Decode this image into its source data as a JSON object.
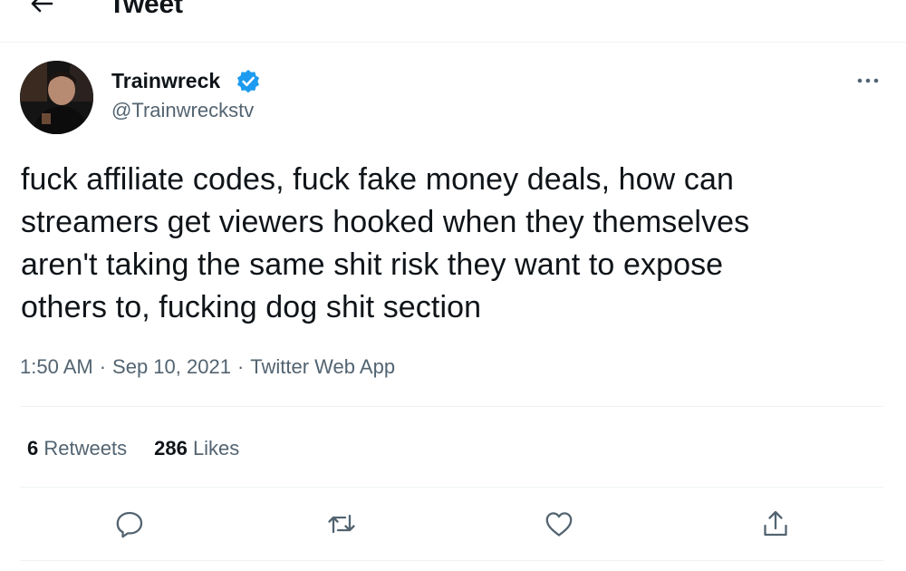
{
  "header": {
    "title": "Tweet",
    "back_icon": "back-arrow-icon"
  },
  "author": {
    "name": "Trainwreck",
    "handle": "@Trainwreckstv",
    "verified": true,
    "verified_color": "#1d9bf0"
  },
  "tweet": {
    "text": "fuck affiliate codes, fuck fake money deals, how can\nstreamers get viewers hooked when they themselves\naren't taking the same shit risk they want to expose\nothers to, fucking dog shit section",
    "time": "1:50 AM",
    "date": "Sep 10, 2021",
    "source": "Twitter Web App",
    "separator": "·"
  },
  "stats": {
    "retweets_count": "6",
    "retweets_label": "Retweets",
    "likes_count": "286",
    "likes_label": "Likes"
  },
  "actions": [
    "reply-icon",
    "retweet-icon",
    "like-icon",
    "share-icon"
  ],
  "colors": {
    "text_primary": "#0f1419",
    "text_secondary": "#536471",
    "divider": "#eff3f4"
  }
}
